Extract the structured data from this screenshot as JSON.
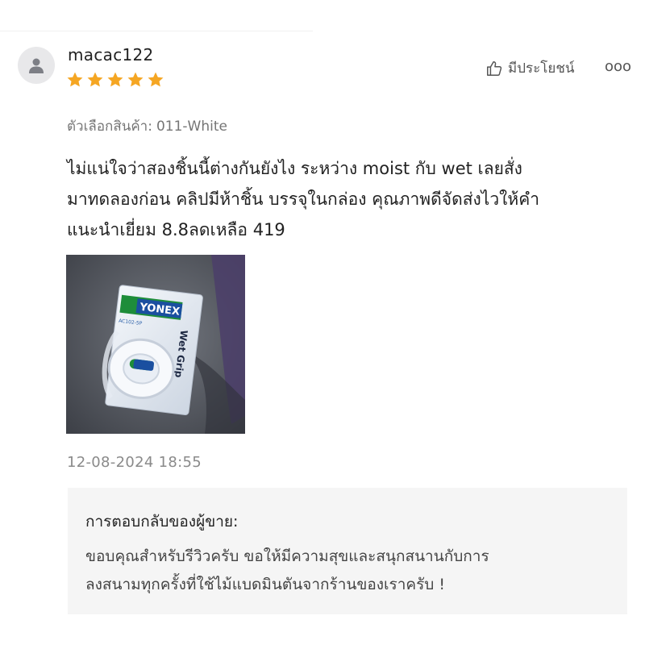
{
  "review": {
    "username": "macac122",
    "rating": 5,
    "rating_max": 5,
    "helpful_label": "มีประโยชน์",
    "more_label": "ooo",
    "variation_label": "ตัวเลือกสินค้า:",
    "variation_value": "011-White",
    "text_lines": [
      "ไม่แน่ใจว่าสองชิ้นนี้ต่างกันยังไง ระหว่าง moist กับ wet เลยสั่ง",
      "มาทดลองก่อน คลิปมีห้าชิ้น บรรจุในกล่อง คุณภาพดีจัดส่งไวให้คำ",
      "แนะนำเยี่ยม 8.8ลดเหลือ 419"
    ],
    "photo": {
      "brand_text": "YONEX",
      "product_text": "Wet Grip",
      "code_text": "AC102-5P"
    },
    "timestamp": "12-08-2024 18:55"
  },
  "seller_reply": {
    "title": "การตอบกลับของผู้ขาย:",
    "lines": [
      "ขอบคุณสำหรับรีวิวครับ ขอให้มีความสุขและสนุกสนานกับการ",
      "ลงสนามทุกครั้งที่ใช้ไม้แบดมินตันจากร้านของเราครับ !"
    ]
  },
  "colors": {
    "star": "#f5a623",
    "reply_bg": "#f5f5f5",
    "muted_text": "#757575"
  },
  "icons": {
    "avatar": "person-icon",
    "helpful": "thumbs-up-icon",
    "rating": "star-icon"
  }
}
